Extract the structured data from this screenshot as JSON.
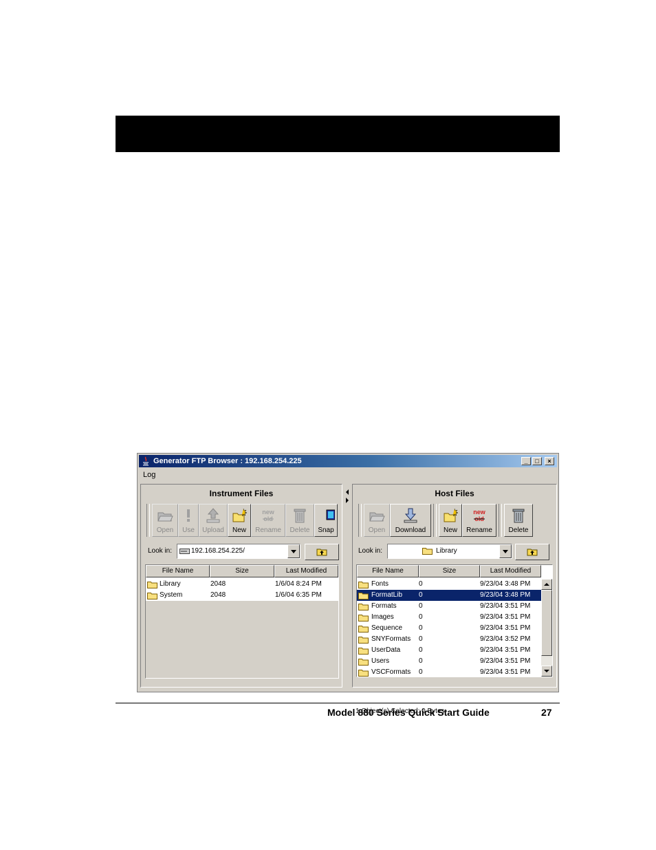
{
  "window": {
    "title": "Generator FTP Browser : 192.168.254.225",
    "menu": [
      "Log"
    ],
    "controls": [
      "minimize",
      "maximize",
      "close"
    ]
  },
  "instrument": {
    "title": "Instrument Files",
    "buttons": [
      {
        "label": "Open",
        "icon": "folder-open-icon",
        "enabled": false
      },
      {
        "label": "Use",
        "icon": "exclamation-icon",
        "enabled": false
      },
      {
        "label": "Upload",
        "icon": "upload-arrow-icon",
        "enabled": false
      },
      {
        "label": "New",
        "icon": "new-folder-icon",
        "enabled": true
      },
      {
        "label": "Rename",
        "icon": "rename-icon",
        "enabled": false
      },
      {
        "label": "Delete",
        "icon": "trash-icon",
        "enabled": false
      },
      {
        "label": "Snap",
        "icon": "snapshot-icon",
        "enabled": true
      }
    ],
    "look_in_label": "Look in:",
    "look_in_value": "192.168.254.225/",
    "columns": [
      "File Name",
      "Size",
      "Last Modified"
    ],
    "rows": [
      {
        "name": "Library",
        "size": "2048",
        "modified": "1/6/04 8:24 PM"
      },
      {
        "name": "System",
        "size": "2048",
        "modified": "1/6/04 6:35 PM"
      }
    ]
  },
  "host": {
    "title": "Host Files",
    "buttons": [
      {
        "label": "Open",
        "icon": "folder-open-icon",
        "enabled": false
      },
      {
        "label": "Download",
        "icon": "download-arrow-icon",
        "enabled": true
      },
      {
        "label": "New",
        "icon": "new-folder-icon",
        "enabled": true
      },
      {
        "label": "Rename",
        "icon": "rename-icon",
        "enabled": true
      },
      {
        "label": "Delete",
        "icon": "trash-icon",
        "enabled": true
      }
    ],
    "look_in_label": "Look in:",
    "look_in_value": "Library",
    "columns": [
      "File Name",
      "Size",
      "Last Modified"
    ],
    "rows": [
      {
        "name": "Fonts",
        "size": "0",
        "modified": "9/23/04 3:48 PM"
      },
      {
        "name": "FormatLib",
        "size": "0",
        "modified": "9/23/04 3:48 PM",
        "selected": true
      },
      {
        "name": "Formats",
        "size": "0",
        "modified": "9/23/04 3:51 PM"
      },
      {
        "name": "Images",
        "size": "0",
        "modified": "9/23/04 3:51 PM"
      },
      {
        "name": "Sequence",
        "size": "0",
        "modified": "9/23/04 3:51 PM"
      },
      {
        "name": "SNYFormats",
        "size": "0",
        "modified": "9/23/04 3:52 PM"
      },
      {
        "name": "UserData",
        "size": "0",
        "modified": "9/23/04 3:51 PM"
      },
      {
        "name": "Users",
        "size": "0",
        "modified": "9/23/04 3:51 PM"
      },
      {
        "name": "VSCFormats",
        "size": "0",
        "modified": "9/23/04 3:51 PM"
      }
    ],
    "status": "1 Object(s) Selected:  0 Bytes"
  },
  "footer": {
    "title": "Model 880 Series Quick Start Guide",
    "page": "27"
  },
  "icon_text": {
    "new": "new",
    "old": "old"
  }
}
